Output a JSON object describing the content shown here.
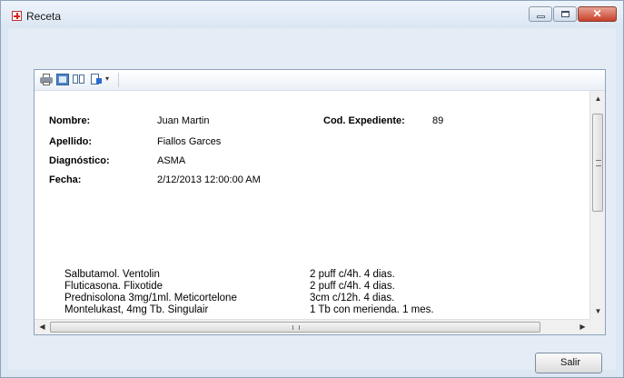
{
  "window": {
    "title": "Receta"
  },
  "toolbar": {
    "dropdown_glyph": "▾"
  },
  "report": {
    "fields": {
      "nombre": {
        "label": "Nombre:",
        "value": "Juan Martin"
      },
      "apellido": {
        "label": "Apellido:",
        "value": "Fiallos Garces"
      },
      "diagnostico": {
        "label": "Diagnóstico:",
        "value": "ASMA"
      },
      "fecha": {
        "label": "Fecha:",
        "value": "2/12/2013 12:00:00 AM"
      },
      "expediente": {
        "label": "Cod. Expediente:",
        "value": "89"
      }
    },
    "medications": [
      {
        "name": "Salbutamol. Ventolin",
        "dosage": "2 puff c/4h. 4 dias."
      },
      {
        "name": "Fluticasona. Flixotide",
        "dosage": "2 puff c/4h. 4 dias."
      },
      {
        "name": "Prednisolona 3mg/1ml. Meticortelone",
        "dosage": "3cm c/12h. 4 dias."
      },
      {
        "name": "Montelukast, 4mg Tb.  Singulair",
        "dosage": "1 Tb con merienda. 1 mes."
      }
    ]
  },
  "buttons": {
    "exit_label": "Salir"
  },
  "icons": [
    "app-icon",
    "print-icon",
    "page-layout-icon",
    "page-setup-icon",
    "export-icon"
  ]
}
